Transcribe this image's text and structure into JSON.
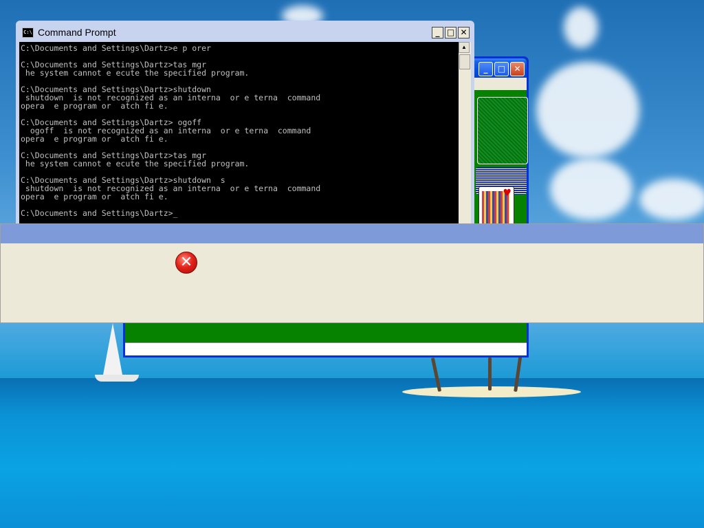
{
  "command_prompt": {
    "title": "Command Prompt",
    "icon_label": "C:\\",
    "minimize": "_",
    "maximize": "□",
    "close": "✕",
    "lines": [
      "C:\\Documents and Settings\\Dartz>e p orer",
      "",
      "C:\\Documents and Settings\\Dartz>tas mgr",
      " he system cannot e ecute the specified program.",
      "",
      "C:\\Documents and Settings\\Dartz>shutdown",
      " shutdown  is not recognized as an interna  or e terna  command",
      "opera  e program or  atch fi e.",
      "",
      "C:\\Documents and Settings\\Dartz> ogoff",
      "  ogoff  is not recognized as an interna  or e terna  command",
      "opera  e program or  atch fi e.",
      "",
      "C:\\Documents and Settings\\Dartz>tas mgr",
      " he system cannot e ecute the specified program.",
      "",
      "C:\\Documents and Settings\\Dartz>shutdown  s",
      " shutdown  is not recognized as an interna  or e terna  command",
      "opera  e program or  atch fi e.",
      "",
      "C:\\Documents and Settings\\Dartz>_"
    ]
  },
  "solitaire": {
    "minimize": "_",
    "maximize": "□",
    "close": "✕",
    "card_suit": "♥"
  },
  "error_dialog": {
    "icon": "✕"
  }
}
